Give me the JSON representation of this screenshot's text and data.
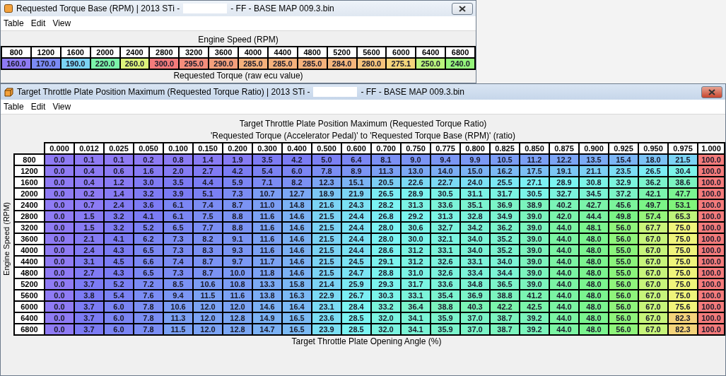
{
  "windows": [
    {
      "kind": "axis1d",
      "title_before": "Requested Torque Base (RPM) | 2013 STi -",
      "title_after": "- FF - BASE MAP 009.3.bin",
      "active": false,
      "menu": [
        "Table",
        "Edit",
        "View"
      ],
      "x_axis_title": "Engine Speed (RPM)",
      "columns": [
        "800",
        "1200",
        "1600",
        "2000",
        "2400",
        "2800",
        "3200",
        "3600",
        "4000",
        "4400",
        "4800",
        "5200",
        "5600",
        "6000",
        "6400",
        "6800"
      ],
      "values": [
        "160.0",
        "170.0",
        "190.0",
        "220.0",
        "260.0",
        "300.0",
        "295.0",
        "290.0",
        "285.0",
        "285.0",
        "285.0",
        "284.0",
        "280.0",
        "275.1",
        "250.0",
        "240.0"
      ],
      "value_label": "Requested Torque (raw ecu value)"
    },
    {
      "kind": "axis2d",
      "title_before": "Target Throttle Plate Position Maximum (Requested Torque Ratio) | 2013 STi -",
      "title_after": "- FF - BASE MAP 009.3.bin",
      "active": true,
      "menu": [
        "Table",
        "Edit",
        "View"
      ],
      "table_title": "Target Throttle Plate Position Maximum (Requested Torque Ratio)",
      "table_subtitle": "'Requested Torque (Accelerator Pedal)' to 'Requested Torque Base (RPM)' (ratio)",
      "y_axis_title": "Engine Speed (RPM)",
      "x_axis_title": "Target Throttle Plate Opening Angle (%)",
      "columns": [
        "0.000",
        "0.012",
        "0.025",
        "0.050",
        "0.100",
        "0.150",
        "0.200",
        "0.300",
        "0.400",
        "0.500",
        "0.600",
        "0.700",
        "0.750",
        "0.775",
        "0.800",
        "0.825",
        "0.850",
        "0.875",
        "0.900",
        "0.925",
        "0.950",
        "0.975",
        "1.000"
      ],
      "rows": [
        {
          "label": "800",
          "values": [
            "0.0",
            "0.1",
            "0.1",
            "0.2",
            "0.8",
            "1.4",
            "1.9",
            "3.5",
            "4.2",
            "5.0",
            "6.4",
            "8.1",
            "9.0",
            "9.4",
            "9.9",
            "10.5",
            "11.2",
            "12.2",
            "13.5",
            "15.4",
            "18.0",
            "21.5",
            "100.0"
          ]
        },
        {
          "label": "1200",
          "values": [
            "0.0",
            "0.4",
            "0.6",
            "1.6",
            "2.0",
            "2.7",
            "4.2",
            "5.4",
            "6.0",
            "7.8",
            "8.9",
            "11.3",
            "13.0",
            "14.0",
            "15.0",
            "16.2",
            "17.5",
            "19.1",
            "21.1",
            "23.5",
            "26.5",
            "30.4",
            "100.0"
          ]
        },
        {
          "label": "1600",
          "values": [
            "0.0",
            "0.4",
            "1.2",
            "3.0",
            "3.5",
            "4.4",
            "5.9",
            "7.1",
            "8.2",
            "12.3",
            "15.1",
            "20.5",
            "22.6",
            "22.7",
            "24.0",
            "25.5",
            "27.1",
            "28.9",
            "30.8",
            "32.9",
            "36.2",
            "38.6",
            "100.0"
          ]
        },
        {
          "label": "2000",
          "values": [
            "0.0",
            "0.2",
            "1.4",
            "3.2",
            "3.9",
            "5.1",
            "7.3",
            "10.7",
            "12.7",
            "18.9",
            "21.9",
            "26.5",
            "28.9",
            "30.5",
            "31.1",
            "31.7",
            "30.5",
            "32.7",
            "34.5",
            "37.2",
            "42.1",
            "47.7",
            "100.0"
          ]
        },
        {
          "label": "2400",
          "values": [
            "0.0",
            "0.7",
            "2.4",
            "3.6",
            "6.1",
            "7.4",
            "8.7",
            "11.0",
            "14.8",
            "21.6",
            "24.3",
            "28.2",
            "31.3",
            "33.6",
            "35.1",
            "36.9",
            "38.9",
            "40.2",
            "42.7",
            "45.6",
            "49.7",
            "53.1",
            "100.0"
          ]
        },
        {
          "label": "2800",
          "values": [
            "0.0",
            "1.5",
            "3.2",
            "4.1",
            "6.1",
            "7.5",
            "8.8",
            "11.6",
            "14.6",
            "21.5",
            "24.4",
            "26.8",
            "29.2",
            "31.3",
            "32.8",
            "34.9",
            "39.0",
            "42.0",
            "44.4",
            "49.8",
            "57.4",
            "65.3",
            "100.0"
          ]
        },
        {
          "label": "3200",
          "values": [
            "0.0",
            "1.5",
            "3.2",
            "5.2",
            "6.5",
            "7.7",
            "8.8",
            "11.6",
            "14.6",
            "21.5",
            "24.4",
            "28.0",
            "30.6",
            "32.7",
            "34.2",
            "36.2",
            "39.0",
            "44.0",
            "48.1",
            "56.0",
            "67.7",
            "75.0",
            "100.0"
          ]
        },
        {
          "label": "3600",
          "values": [
            "0.0",
            "2.1",
            "4.1",
            "6.2",
            "7.3",
            "8.2",
            "9.1",
            "11.6",
            "14.6",
            "21.5",
            "24.4",
            "28.0",
            "30.0",
            "32.1",
            "34.0",
            "35.2",
            "39.0",
            "44.0",
            "48.0",
            "56.0",
            "67.0",
            "75.0",
            "100.0"
          ]
        },
        {
          "label": "4000",
          "values": [
            "0.0",
            "2.4",
            "4.3",
            "6.5",
            "7.3",
            "8.3",
            "9.3",
            "11.6",
            "14.6",
            "21.5",
            "24.4",
            "28.6",
            "31.2",
            "33.1",
            "34.0",
            "35.2",
            "39.0",
            "44.0",
            "48.0",
            "55.0",
            "67.0",
            "75.0",
            "100.0"
          ]
        },
        {
          "label": "4400",
          "values": [
            "0.0",
            "3.1",
            "4.5",
            "6.6",
            "7.4",
            "8.7",
            "9.7",
            "11.7",
            "14.6",
            "21.5",
            "24.5",
            "29.1",
            "31.2",
            "32.6",
            "33.1",
            "34.0",
            "39.0",
            "44.0",
            "48.0",
            "55.0",
            "67.0",
            "75.0",
            "100.0"
          ]
        },
        {
          "label": "4800",
          "values": [
            "0.0",
            "2.7",
            "4.3",
            "6.5",
            "7.3",
            "8.7",
            "10.0",
            "11.8",
            "14.6",
            "21.5",
            "24.7",
            "28.8",
            "31.0",
            "32.6",
            "33.4",
            "34.4",
            "39.0",
            "44.0",
            "48.0",
            "55.0",
            "67.0",
            "75.0",
            "100.0"
          ]
        },
        {
          "label": "5200",
          "values": [
            "0.0",
            "3.7",
            "5.2",
            "7.2",
            "8.5",
            "10.6",
            "10.8",
            "13.3",
            "15.8",
            "21.4",
            "25.9",
            "29.3",
            "31.7",
            "33.6",
            "34.8",
            "36.5",
            "39.0",
            "44.0",
            "48.0",
            "56.0",
            "67.0",
            "75.0",
            "100.0"
          ]
        },
        {
          "label": "5600",
          "values": [
            "0.0",
            "3.8",
            "5.4",
            "7.6",
            "9.4",
            "11.5",
            "11.6",
            "13.8",
            "16.3",
            "22.9",
            "26.7",
            "30.3",
            "33.1",
            "35.4",
            "36.9",
            "38.8",
            "41.2",
            "44.0",
            "48.0",
            "56.0",
            "67.0",
            "75.0",
            "100.0"
          ]
        },
        {
          "label": "6000",
          "values": [
            "0.0",
            "3.7",
            "6.0",
            "7.8",
            "10.6",
            "12.0",
            "12.0",
            "14.6",
            "16.4",
            "23.1",
            "28.4",
            "33.2",
            "36.4",
            "38.8",
            "40.3",
            "42.2",
            "42.5",
            "44.0",
            "48.0",
            "56.0",
            "67.0",
            "75.6",
            "100.0"
          ]
        },
        {
          "label": "6400",
          "values": [
            "0.0",
            "3.7",
            "6.0",
            "7.8",
            "11.3",
            "12.0",
            "12.8",
            "14.9",
            "16.5",
            "23.6",
            "28.5",
            "32.0",
            "34.1",
            "35.9",
            "37.0",
            "38.7",
            "39.2",
            "44.0",
            "48.0",
            "56.0",
            "67.0",
            "82.3",
            "100.0"
          ]
        },
        {
          "label": "6800",
          "values": [
            "0.0",
            "3.7",
            "6.0",
            "7.8",
            "11.5",
            "12.0",
            "12.8",
            "14.7",
            "16.5",
            "23.9",
            "28.5",
            "32.0",
            "34.1",
            "35.9",
            "37.0",
            "38.7",
            "39.2",
            "44.0",
            "48.0",
            "56.0",
            "67.0",
            "82.3",
            "100.0"
          ]
        }
      ]
    }
  ]
}
